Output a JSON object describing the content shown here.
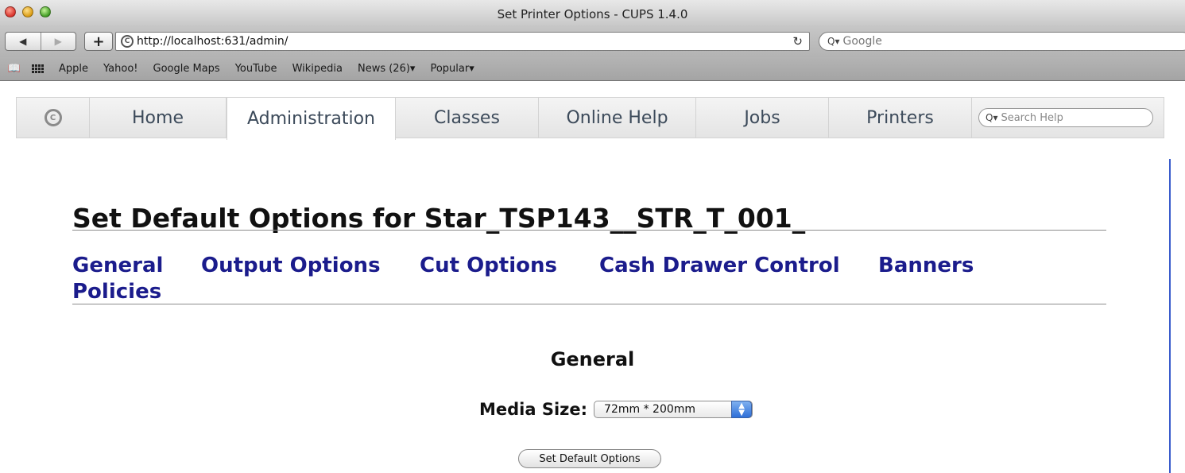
{
  "window": {
    "title": "Set Printer Options - CUPS 1.4.0"
  },
  "toolbar": {
    "back_glyph": "◀",
    "forward_glyph": "▶",
    "add_glyph": "+",
    "url": "http://localhost:631/admin/",
    "reload_glyph": "↻",
    "search_placeholder": "Google",
    "search_glyph": "Q▾"
  },
  "bookmarks": {
    "items": [
      "Apple",
      "Yahoo!",
      "Google Maps",
      "YouTube",
      "Wikipedia",
      "News (26)▾",
      "Popular▾"
    ]
  },
  "cups_nav": {
    "logo_glyph": "C",
    "tabs": [
      "Home",
      "Administration",
      "Classes",
      "Online Help",
      "Jobs",
      "Printers"
    ],
    "active_tab": "Administration",
    "help_search_placeholder": "Search Help",
    "help_search_glyph": "Q▾"
  },
  "content": {
    "title": "Set Default Options for Star_TSP143__STR_T_001_",
    "section_links": [
      "General",
      "Output Options",
      "Cut Options",
      "Cash Drawer Control",
      "Banners",
      "Policies"
    ],
    "section_heading": "General",
    "media_size_label": "Media Size:",
    "media_size_value": "72mm * 200mm",
    "submit_label": "Set Default Options"
  },
  "colors": {
    "link": "#1b1c8c",
    "select_accent": "#2e6fd8"
  }
}
